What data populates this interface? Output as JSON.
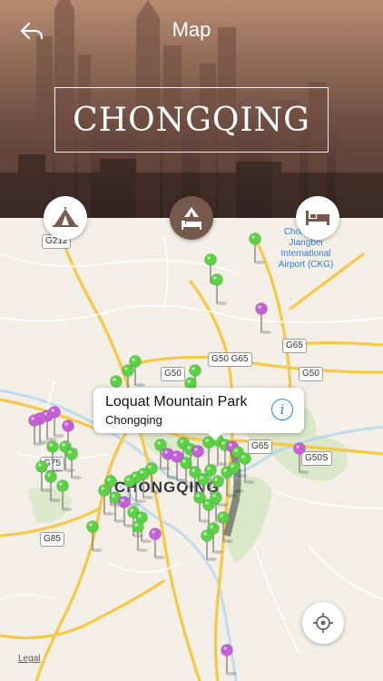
{
  "header": {
    "title": "Map",
    "city": "CHONGQING",
    "back_icon": "back-arrow-icon"
  },
  "tabs": [
    {
      "name": "attractions",
      "icon": "tent-icon",
      "active": false
    },
    {
      "name": "camping-hotels",
      "icon": "tent-bed-icon",
      "active": true
    },
    {
      "name": "hotels",
      "icon": "bed-icon",
      "active": false
    }
  ],
  "map": {
    "road_labels": [
      "G212",
      "G65",
      "G50",
      "G50 G65",
      "G50",
      "G65",
      "G50S",
      "G75",
      "G85"
    ],
    "airport_label": "Chongqing Jiangbei International Airport (CKG)",
    "city_label": "CHONGQING",
    "legal": "Legal",
    "pin_colors": {
      "green": "#5cd146",
      "purple": "#c45fd6"
    }
  },
  "callout": {
    "title": "Loquat Mountain Park",
    "subtitle": "Chongqing",
    "info_icon": "info-icon"
  },
  "locate_icon": "crosshair-icon"
}
